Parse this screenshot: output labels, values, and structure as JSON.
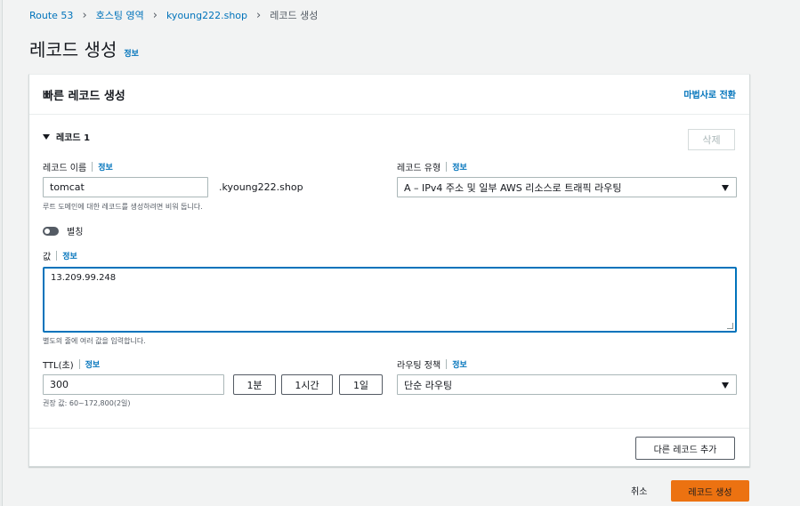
{
  "breadcrumb": {
    "items": [
      "Route 53",
      "호스팅 영역",
      "kyoung222.shop",
      "레코드 생성"
    ]
  },
  "page": {
    "title": "레코드 생성",
    "info": "정보"
  },
  "panel": {
    "title": "빠른 레코드 생성",
    "wizard_link": "마법사로 전환"
  },
  "record": {
    "heading": "레코드 1",
    "delete_label": "삭제",
    "name": {
      "label": "레코드 이름",
      "info": "정보",
      "value": "tomcat",
      "suffix": ".kyoung222.shop",
      "hint": "루트 도메인에 대한 레코드를 생성하려면 비워 둡니다."
    },
    "type": {
      "label": "레코드 유형",
      "info": "정보",
      "value": "A – IPv4 주소 및 일부 AWS 리소스로 트래픽 라우팅"
    },
    "alias": {
      "label": "별칭",
      "enabled": false
    },
    "value": {
      "label": "값",
      "info": "정보",
      "value": "13.209.99.248",
      "hint": "별도의 줄에 여러 값을 입력합니다."
    },
    "ttl": {
      "label": "TTL(초)",
      "info": "정보",
      "value": "300",
      "presets": [
        "1분",
        "1시간",
        "1일"
      ],
      "hint": "권장 값: 60~172,800(2일)"
    },
    "routing": {
      "label": "라우팅 정책",
      "info": "정보",
      "value": "단순 라우팅"
    }
  },
  "actions": {
    "add_record": "다른 레코드 추가",
    "cancel": "취소",
    "create": "레코드 생성"
  },
  "colors": {
    "accent": "#0073bb",
    "primary_button": "#ec7211",
    "background": "#f2f3f3"
  }
}
